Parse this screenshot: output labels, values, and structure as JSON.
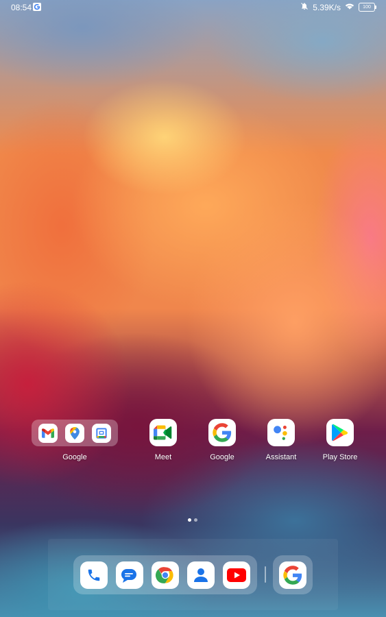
{
  "status_bar": {
    "time": "08:54",
    "network_speed": "5.39K/s",
    "battery": "100",
    "icons": [
      "google-notification-icon",
      "mute-icon",
      "wifi-icon",
      "battery-icon"
    ]
  },
  "home": {
    "folder": {
      "label": "Google",
      "apps": [
        "gmail-icon",
        "maps-icon",
        "calendar-icon"
      ]
    },
    "apps": [
      {
        "label": "Meet",
        "icon": "meet-icon"
      },
      {
        "label": "Google",
        "icon": "google-icon"
      },
      {
        "label": "Assistant",
        "icon": "assistant-icon"
      },
      {
        "label": "Play Store",
        "icon": "play-store-icon"
      }
    ],
    "page_indicator": {
      "pages": 2,
      "active": 1
    }
  },
  "dock": {
    "apps": [
      "phone-icon",
      "messages-icon",
      "chrome-icon",
      "contacts-icon",
      "youtube-icon"
    ],
    "recent": "google-icon"
  },
  "colors": {
    "google_blue": "#4285F4",
    "google_red": "#EA4335",
    "google_yellow": "#FBBC05",
    "google_green": "#34A853",
    "youtube_red": "#FF0000"
  }
}
